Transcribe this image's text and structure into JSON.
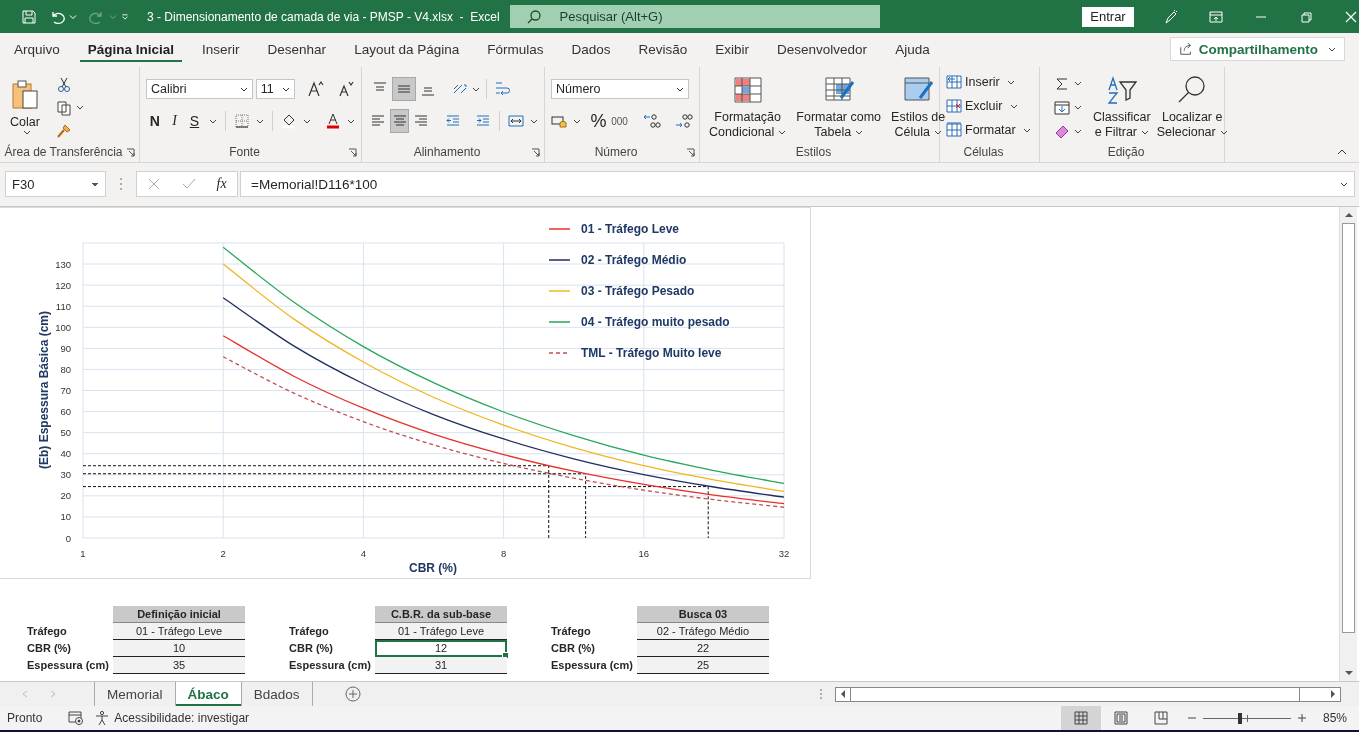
{
  "title_bar": {
    "title": "3 - Dimensionamento de camada de via - PMSP - V4.xlsx  -  Excel",
    "search_placeholder": "Pesquisar (Alt+G)",
    "sign_in": "Entrar"
  },
  "menu_tabs": [
    {
      "label": "Arquivo",
      "selected": false
    },
    {
      "label": "Página Inicial",
      "selected": true
    },
    {
      "label": "Inserir",
      "selected": false
    },
    {
      "label": "Desenhar",
      "selected": false
    },
    {
      "label": "Layout da Página",
      "selected": false
    },
    {
      "label": "Fórmulas",
      "selected": false
    },
    {
      "label": "Dados",
      "selected": false
    },
    {
      "label": "Revisão",
      "selected": false
    },
    {
      "label": "Exibir",
      "selected": false
    },
    {
      "label": "Desenvolvedor",
      "selected": false
    },
    {
      "label": "Ajuda",
      "selected": false
    }
  ],
  "share": "Compartilhamento",
  "ribbon": {
    "clipboard": {
      "label": "Área de Transferência",
      "paste": "Colar"
    },
    "font": {
      "label": "Fonte",
      "family": "Calibri",
      "size": "11",
      "bold": "N",
      "italic": "I",
      "underline": "S"
    },
    "alignment": {
      "label": "Alinhamento",
      "vertical": [
        {
          "selected": false
        },
        {
          "selected": true
        },
        {
          "selected": false
        }
      ],
      "horizontal": [
        {
          "selected": false
        },
        {
          "selected": true
        },
        {
          "selected": false
        }
      ]
    },
    "number": {
      "label": "Número",
      "format": "Número",
      "percent": "%",
      "thousands": "000"
    },
    "styles": {
      "label": "Estilos",
      "buttons": [
        {
          "line1": "Formatação",
          "line2": "Condicional"
        },
        {
          "line1": "Formatar como",
          "line2": "Tabela"
        },
        {
          "line1": "Estilos de",
          "line2": "Célula"
        }
      ]
    },
    "cells": {
      "label": "Células",
      "buttons": [
        "Inserir",
        "Excluir",
        "Formatar"
      ]
    },
    "editing": {
      "label": "Edição",
      "buttons": [
        {
          "line1": "Classificar",
          "line2": "e Filtrar"
        },
        {
          "line1": "Localizar e",
          "line2": "Selecionar"
        }
      ]
    }
  },
  "formula_bar": {
    "name_box": "F30",
    "fx": "fx",
    "formula": "=Memorial!D116*100"
  },
  "chart": {
    "chart_data": {
      "type": "line",
      "grid": true,
      "legend": "upper right",
      "xlabel": "CBR (%)",
      "ylabel": "(Eb) Espessura Básica (cm)",
      "categories": [
        "1",
        null,
        "2",
        null,
        "4",
        null,
        "8",
        null,
        "16",
        null,
        "32"
      ],
      "ylim": [
        0,
        140
      ],
      "yticks": [
        0,
        10,
        20,
        30,
        40,
        50,
        60,
        70,
        80,
        90,
        100,
        110,
        120,
        130
      ],
      "series": [
        {
          "name": "01 - Tráfego Leve",
          "color": "#e8302a",
          "line_style": "solid",
          "values": [
            null,
            null,
            96,
            76.9,
            61.6,
            49.3,
            39.6,
            31.7,
            25.4,
            20.3,
            16.3
          ]
        },
        {
          "name": "02 - Tráfego Médio",
          "color": "#1f2d5c",
          "line_style": "solid",
          "values": [
            null,
            null,
            114,
            91.3,
            73.2,
            58.6,
            47,
            37.6,
            30.1,
            24.2,
            19.4
          ]
        },
        {
          "name": "03 - Tráfego Pesado",
          "color": "#f2b51f",
          "line_style": "solid",
          "values": [
            null,
            null,
            130,
            104.1,
            83.5,
            66.8,
            53.6,
            42.9,
            34.3,
            27.6,
            22.1
          ]
        },
        {
          "name": "04 - Tráfego muito pesado",
          "color": "#2aa65a",
          "line_style": "solid",
          "values": [
            null,
            null,
            138,
            112.1,
            90.8,
            73.7,
            59.8,
            48.6,
            39.3,
            32,
            25.9
          ]
        },
        {
          "name": "TML - Tráfego Muito leve",
          "color": "#c0504d",
          "line_style": "dashed",
          "values": [
            null,
            null,
            86,
            68.9,
            55.2,
            44.2,
            35.4,
            28.4,
            22.7,
            18.2,
            14.6
          ]
        }
      ],
      "ref_lines": [
        {
          "axis": "y",
          "value": 34.3,
          "color": "#111111",
          "line_style": "dashed"
        },
        {
          "axis": "y",
          "value": 30.5,
          "color": "#111111",
          "line_style": "dashed"
        },
        {
          "axis": "y",
          "value": 24.4,
          "color": "#111111",
          "line_style": "dashed"
        }
      ]
    }
  },
  "tables": [
    {
      "header": "Definição inicial",
      "rows": [
        {
          "label": "Tráfego",
          "value": "01 - Tráfego Leve",
          "selected": false
        },
        {
          "label": "CBR (%)",
          "value": "10",
          "selected": false
        },
        {
          "label": "Espessura (cm)",
          "value": "35",
          "selected": false
        }
      ]
    },
    {
      "header": "C.B.R. da sub-base",
      "rows": [
        {
          "label": "Tráfego",
          "value": "01 - Tráfego Leve",
          "selected": false
        },
        {
          "label": "CBR (%)",
          "value": "12",
          "selected": true
        },
        {
          "label": "Espessura (cm)",
          "value": "31",
          "selected": false
        }
      ]
    },
    {
      "header": "Busca 03",
      "rows": [
        {
          "label": "Tráfego",
          "value": "02 - Tráfego Médio",
          "selected": false
        },
        {
          "label": "CBR (%)",
          "value": "22",
          "selected": false
        },
        {
          "label": "Espessura (cm)",
          "value": "25",
          "selected": false
        }
      ]
    }
  ],
  "sheet_tabs": [
    {
      "label": "Memorial",
      "selected": false
    },
    {
      "label": "Ábaco",
      "selected": true
    },
    {
      "label": "Bdados",
      "selected": false
    }
  ],
  "status_bar": {
    "mode": "Pronto",
    "accessibility": "Acessibilidade: investigar",
    "views": [
      {
        "selected": true
      },
      {
        "selected": false
      },
      {
        "selected": false
      }
    ],
    "zoom": {
      "level": 0.42,
      "label": "85%"
    }
  }
}
